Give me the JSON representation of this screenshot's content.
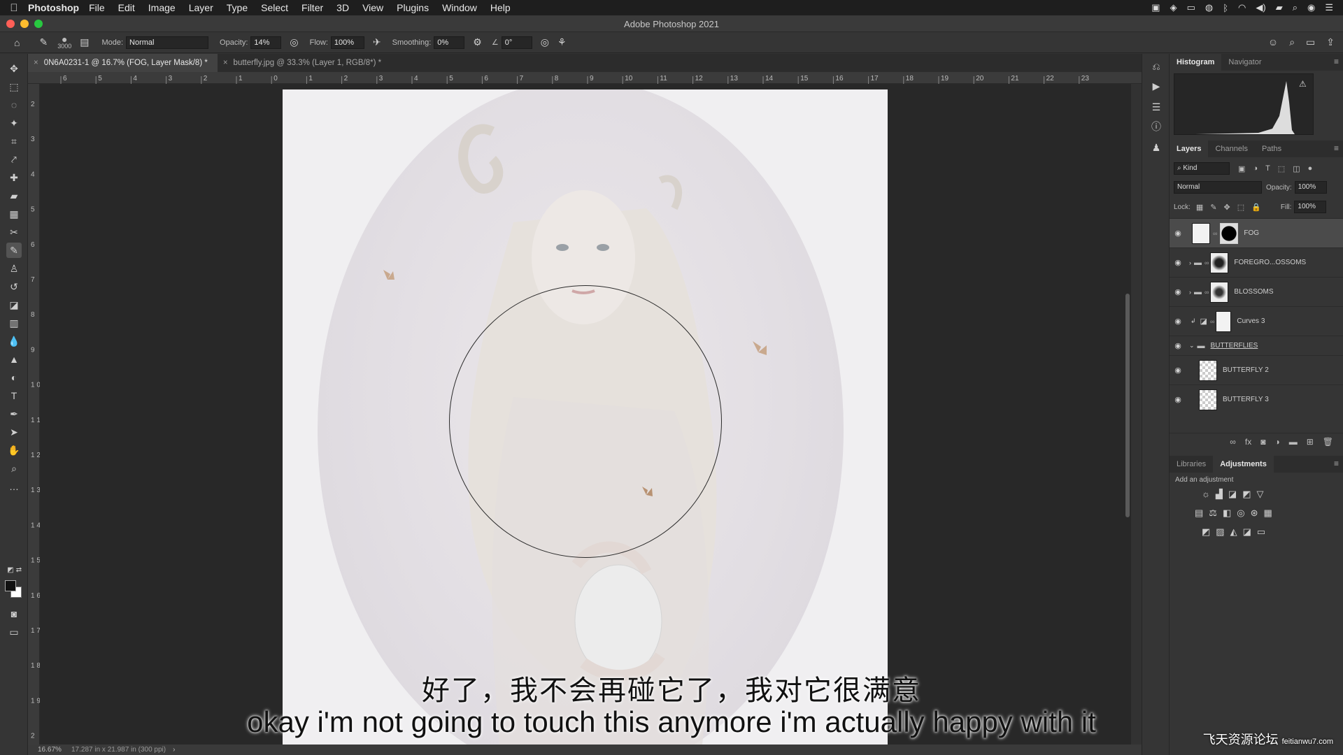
{
  "menubar": {
    "app": "Photoshop",
    "items": [
      "File",
      "Edit",
      "Image",
      "Layer",
      "Type",
      "Select",
      "Filter",
      "3D",
      "View",
      "Plugins",
      "Window",
      "Help"
    ]
  },
  "window": {
    "title": "Adobe Photoshop 2021"
  },
  "options": {
    "brush_size": "3000",
    "mode_label": "Mode:",
    "mode_value": "Normal",
    "opacity_label": "Opacity:",
    "opacity_value": "14%",
    "flow_label": "Flow:",
    "flow_value": "100%",
    "smoothing_label": "Smoothing:",
    "smoothing_value": "0%",
    "angle_value": "0°"
  },
  "tabs": [
    {
      "label": "0N6A0231-1 @ 16.7% (FOG, Layer Mask/8) *"
    },
    {
      "label": "butterfly.jpg @ 33.3% (Layer 1, RGB/8*) *"
    }
  ],
  "ruler": {
    "h_ticks": [
      "6",
      "5",
      "4",
      "3",
      "2",
      "1",
      "0",
      "1",
      "2",
      "3",
      "4",
      "5",
      "6",
      "7",
      "8",
      "9",
      "10",
      "11",
      "12",
      "13",
      "14",
      "15",
      "16",
      "17",
      "18",
      "19",
      "20",
      "21",
      "22",
      "23"
    ],
    "v_ticks": [
      "2",
      "3",
      "4",
      "5",
      "6",
      "7",
      "8",
      "9",
      "1 0",
      "1 1",
      "1 2",
      "1 3",
      "1 4",
      "1 5",
      "1 6",
      "1 7",
      "1 8",
      "1 9",
      "2"
    ]
  },
  "status": {
    "zoom": "16.67%",
    "info": "17.287 in x 21.987 in (300 ppi)"
  },
  "panels": {
    "top_tabs": [
      "Histogram",
      "Navigator"
    ],
    "layer_tabs": [
      "Layers",
      "Channels",
      "Paths"
    ],
    "kind_label": "Kind",
    "blend_mode": "Normal",
    "opacity_label": "Opacity:",
    "opacity_value": "100%",
    "lock_label": "Lock:",
    "fill_label": "Fill:",
    "fill_value": "100%",
    "layers": [
      {
        "name": "FOG"
      },
      {
        "name": "FOREGRO...OSSOMS"
      },
      {
        "name": "BLOSSOMS"
      },
      {
        "name": "Curves 3"
      },
      {
        "name": "BUTTERFLIES"
      },
      {
        "name": "BUTTERFLY 2"
      },
      {
        "name": "BUTTERFLY 3"
      }
    ],
    "bottom_tabs": [
      "Libraries",
      "Adjustments"
    ],
    "add_adjustment": "Add an adjustment"
  },
  "subtitles": {
    "cn": "好了，我不会再碰它了，我对它很满意",
    "en": "okay i'm not going to touch this anymore i'm actually happy with it"
  },
  "watermark": {
    "cn": "飞天资源论坛",
    "url": "feitianwu7.com"
  }
}
